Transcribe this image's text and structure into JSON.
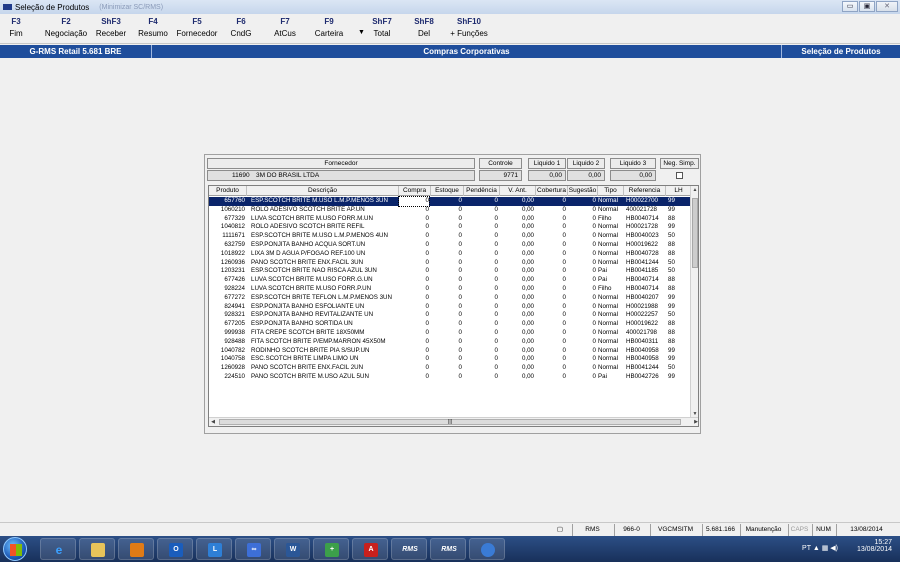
{
  "window": {
    "title": "Seleção de Produtos",
    "title_extra": "(Minimizar SC/RMS)",
    "buttons": {
      "minimize": "▭",
      "maximize": "▣",
      "close": "✕"
    }
  },
  "toolbar": [
    {
      "key": "F3",
      "label": "Fim"
    },
    {
      "key": "F2",
      "label": "Negociação"
    },
    {
      "key": "ShF3",
      "label": "Receber"
    },
    {
      "key": "F4",
      "label": "Resumo"
    },
    {
      "key": "F5",
      "label": "Fornecedor"
    },
    {
      "key": "F6",
      "label": "CndG"
    },
    {
      "key": "F7",
      "label": "AtCus"
    },
    {
      "key": "F9",
      "label": "Carteira"
    },
    {
      "key": "ShF7",
      "label": "Total"
    },
    {
      "key": "ShF8",
      "label": "Del"
    },
    {
      "key": "ShF10",
      "label": "+ Funções"
    }
  ],
  "banner": {
    "left": "G-RMS Retail 5.681 BRE",
    "center": "Compras Corporativas",
    "right": "Seleção de Produtos"
  },
  "summary": {
    "fornecedor_label": "Fornecedor",
    "fornecedor_code": "11690",
    "fornecedor_name": "3M DO BRASIL LTDA",
    "controle_label": "Controle",
    "controle_value": "9771",
    "liquido1_label": "Liquido 1",
    "liquido1_value": "0,00",
    "liquido2_label": "Liquido 2",
    "liquido2_value": "0,00",
    "liquido3_label": "Liquido 3",
    "liquido3_value": "0,00",
    "negsimp_label": "Neg. Simp."
  },
  "grid": {
    "columns": [
      "Produto",
      "Descrição",
      "Compra",
      "Estoque",
      "Pendência",
      "V. Ant.",
      "Cobertura",
      "Sugestão",
      "Tipo",
      "Referencia",
      "LH"
    ],
    "rows": [
      [
        "657760",
        "ESP.SCOTCH BRITE M.USO L.M.P.MENOS 3UN",
        "0",
        "0",
        "0",
        "0,00",
        "0",
        "0",
        "Normal",
        "H00022700",
        "99"
      ],
      [
        "1060210",
        "ROLO ADESIVO SCOTCH BRITE AP.UN",
        "0",
        "0",
        "0",
        "0,00",
        "0",
        "0",
        "Normal",
        "400021728",
        "99"
      ],
      [
        "677329",
        "LUVA SCOTCH BRITE M.USO FORR.M.UN",
        "0",
        "0",
        "0",
        "0,00",
        "0",
        "0",
        "Filho",
        "HB0040714",
        "88"
      ],
      [
        "1040812",
        "ROLO ADESIVO SCOTCH BRITE REFIL",
        "0",
        "0",
        "0",
        "0,00",
        "0",
        "0",
        "Normal",
        "H00021728",
        "99"
      ],
      [
        "1111671",
        "ESP.SCOTCH BRITE M.USO L.M.P.MENOS 4UN",
        "0",
        "0",
        "0",
        "0,00",
        "0",
        "0",
        "Normal",
        "HB0040023",
        "50"
      ],
      [
        "632759",
        "ESP.PONJITA BANHO ACQUA SORT.UN",
        "0",
        "0",
        "0",
        "0,00",
        "0",
        "0",
        "Normal",
        "H00019622",
        "88"
      ],
      [
        "1018922",
        "LIXA 3M D AGUA P/FOGAO REF.100 UN",
        "0",
        "0",
        "0",
        "0,00",
        "0",
        "0",
        "Normal",
        "HB0040728",
        "88"
      ],
      [
        "1260936",
        "PANO SCOTCH BRITE ENX.FACIL 3UN",
        "0",
        "0",
        "0",
        "0,00",
        "0",
        "0",
        "Normal",
        "HB0041244",
        "50"
      ],
      [
        "1203231",
        "ESP.SCOTCH BRITE NAO RISCA AZUL 3UN",
        "0",
        "0",
        "0",
        "0,00",
        "0",
        "0",
        "Pai",
        "HB0041185",
        "50"
      ],
      [
        "677426",
        "LUVA SCOTCH BRITE M.USO FORR.G.UN",
        "0",
        "0",
        "0",
        "0,00",
        "0",
        "0",
        "Pai",
        "HB0040714",
        "88"
      ],
      [
        "928224",
        "LUVA SCOTCH BRITE M.USO FORR.P.UN",
        "0",
        "0",
        "0",
        "0,00",
        "0",
        "0",
        "Filho",
        "HB0040714",
        "88"
      ],
      [
        "677272",
        "ESP.SCOTCH BRITE TEFLON L.M.P.MENOS 3UN",
        "0",
        "0",
        "0",
        "0,00",
        "0",
        "0",
        "Normal",
        "HB0040207",
        "99"
      ],
      [
        "824941",
        "ESP.PONJITA BANHO ESFOLIANTE UN",
        "0",
        "0",
        "0",
        "0,00",
        "0",
        "0",
        "Normal",
        "H00021988",
        "99"
      ],
      [
        "928321",
        "ESP.PONJITA BANHO REVITALIZANTE UN",
        "0",
        "0",
        "0",
        "0,00",
        "0",
        "0",
        "Normal",
        "H00022257",
        "50"
      ],
      [
        "677205",
        "ESP.PONJITA BANHO SORTIDA UN",
        "0",
        "0",
        "0",
        "0,00",
        "0",
        "0",
        "Normal",
        "H00019622",
        "88"
      ],
      [
        "999938",
        "FITA CREPE SCOTCH BRITE 18X50MM",
        "0",
        "0",
        "0",
        "0,00",
        "0",
        "0",
        "Normal",
        "400021798",
        "88"
      ],
      [
        "928488",
        "FITA SCOTCH BRITE P/EMP.MARRON 45X50M",
        "0",
        "0",
        "0",
        "0,00",
        "0",
        "0",
        "Normal",
        "HB0040311",
        "88"
      ],
      [
        "1040782",
        "RODINHO SCOTCH BRITE PIA S/SUP.UN",
        "0",
        "0",
        "0",
        "0,00",
        "0",
        "0",
        "Normal",
        "HB0040958",
        "99"
      ],
      [
        "1040758",
        "ESC.SCOTCH BRITE LIMPA LIMO UN",
        "0",
        "0",
        "0",
        "0,00",
        "0",
        "0",
        "Normal",
        "HB0040958",
        "99"
      ],
      [
        "1260928",
        "PANO SCOTCH BRITE ENX.FACIL 2UN",
        "0",
        "0",
        "0",
        "0,00",
        "0",
        "0",
        "Normal",
        "HB0041244",
        "50"
      ],
      [
        "224510",
        "PANO SCOTCH BRITE M.USO AZUL 5UN",
        "0",
        "0",
        "0",
        "0,00",
        "0",
        "0",
        "Pai",
        "HB0042726",
        "99"
      ]
    ]
  },
  "statusbar": {
    "app": "RMS",
    "code": "966-0",
    "user": "VGCMSITM",
    "version": "5.681.166",
    "mode": "Manutenção",
    "caps": "CAPS",
    "num": "NUM",
    "date": "13/08/2014"
  },
  "taskbar": {
    "apps": [
      "ie-icon",
      "explorer-icon",
      "media-icon",
      "outlook-icon",
      "lync-icon",
      "connect-icon",
      "word-icon",
      "installer-icon",
      "pdf-icon",
      "rms-icon",
      "rms-icon-2",
      "app-icon"
    ],
    "rms_label": "RMS",
    "tray_lang": "PT",
    "time": "15:27",
    "date": "13/08/2014"
  },
  "colors": {
    "banner": "#1f4e9c",
    "selection": "#0a246a",
    "taskbar": "#18305a"
  }
}
